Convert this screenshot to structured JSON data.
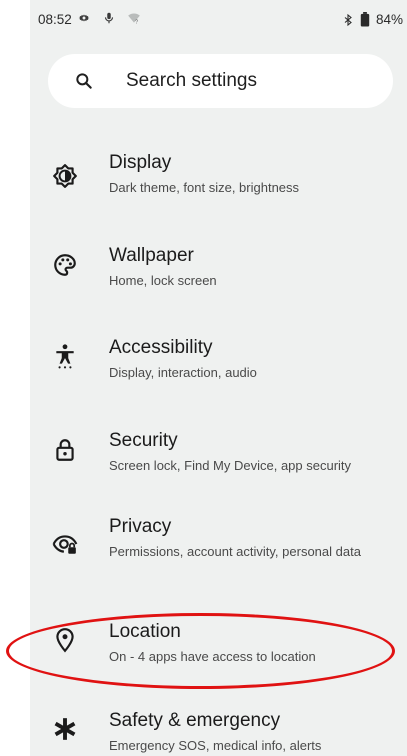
{
  "status_bar": {
    "time": "08:52",
    "battery": "84%",
    "icons": [
      "gear-icon",
      "mic-icon",
      "wifi-icon",
      "bluetooth-icon",
      "battery-icon"
    ]
  },
  "search": {
    "label": "Search settings",
    "icon": "search-icon"
  },
  "items": [
    {
      "title": "Display",
      "subtitle": "Dark theme, font size, brightness",
      "icon": "brightness-icon"
    },
    {
      "title": "Wallpaper",
      "subtitle": "Home, lock screen",
      "icon": "palette-icon"
    },
    {
      "title": "Accessibility",
      "subtitle": "Display, interaction, audio",
      "icon": "accessibility-icon"
    },
    {
      "title": "Security",
      "subtitle": "Screen lock, Find My Device, app security",
      "icon": "lock-icon"
    },
    {
      "title": "Privacy",
      "subtitle": "Permissions, account activity, personal data",
      "icon": "privacy-eye-icon"
    },
    {
      "title": "Location",
      "subtitle": "On - 4 apps have access to location",
      "icon": "location-pin-icon"
    },
    {
      "title": "Safety & emergency",
      "subtitle": "Emergency SOS, medical info, alerts",
      "icon": "asterisk-icon"
    }
  ],
  "colors": {
    "background": "#eff1f0",
    "highlight": "#e01212"
  }
}
